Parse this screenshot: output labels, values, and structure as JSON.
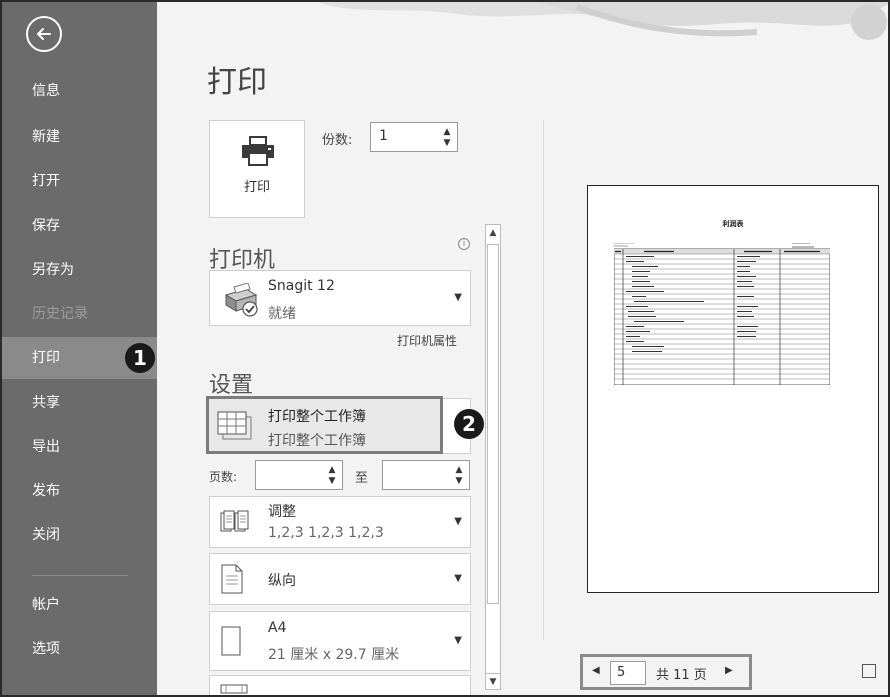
{
  "sidebar": {
    "items": [
      {
        "label": "信息"
      },
      {
        "label": "新建"
      },
      {
        "label": "打开"
      },
      {
        "label": "保存"
      },
      {
        "label": "另存为"
      },
      {
        "label": "历史记录"
      },
      {
        "label": "打印"
      },
      {
        "label": "共享"
      },
      {
        "label": "导出"
      },
      {
        "label": "发布"
      },
      {
        "label": "关闭"
      },
      {
        "label": "帐户"
      },
      {
        "label": "选项"
      }
    ]
  },
  "callouts": {
    "one": "1",
    "two": "2"
  },
  "main": {
    "title": "打印",
    "print_button_label": "打印",
    "copies_label": "份数:",
    "copies_value": "1",
    "printer_head": "打印机",
    "printer_name": "Snagit 12",
    "printer_status": "就绪",
    "printer_props": "打印机属性",
    "settings_head": "设置",
    "scope_title": "打印整个工作簿",
    "scope_sub": "打印整个工作簿",
    "pages_label": "页数:",
    "to_label": "至",
    "collate_title": "调整",
    "collate_sub": "1,2,3    1,2,3    1,2,3",
    "orientation": "纵向",
    "paper_title": "A4",
    "paper_sub": "21 厘米 x 29.7 厘米"
  },
  "preview": {
    "doc_title": "利润表",
    "current_page": "5",
    "total": "共 11 页"
  }
}
